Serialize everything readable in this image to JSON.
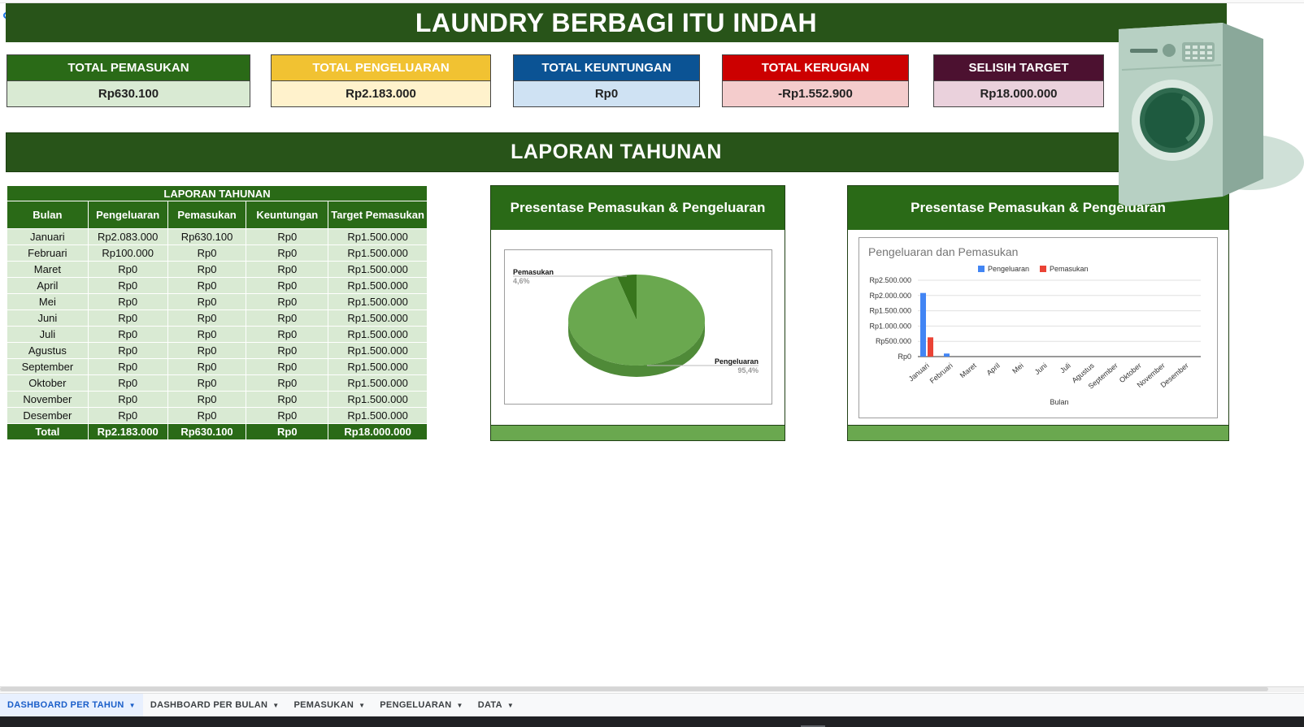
{
  "title": "LAUNDRY BERBAGI ITU INDAH",
  "kpis": [
    {
      "label": "TOTAL PEMASUKAN",
      "value": "Rp630.100"
    },
    {
      "label": "TOTAL PENGELUARAN",
      "value": "Rp2.183.000"
    },
    {
      "label": "TOTAL KEUNTUNGAN",
      "value": "Rp0"
    },
    {
      "label": "TOTAL KERUGIAN",
      "value": "-Rp1.552.900"
    },
    {
      "label": "SELISIH TARGET",
      "value": "Rp18.000.000"
    }
  ],
  "kpi_colors": {
    "pemasukan": {
      "head": "#2a6a17",
      "body": "#d9ead3"
    },
    "pengeluaran": {
      "head": "#f1c232",
      "body": "#fff2cc"
    },
    "keuntungan": {
      "head": "#0b5394",
      "body": "#cfe2f3"
    },
    "kerugian": {
      "head": "#cc0000",
      "body": "#f4cccc"
    },
    "selisih": {
      "head": "#4c1130",
      "body": "#ead1dc"
    }
  },
  "section_title": "LAPORAN TAHUNAN",
  "table": {
    "caption": "LAPORAN TAHUNAN",
    "headers": [
      "Bulan",
      "Pengeluaran",
      "Pemasukan",
      "Keuntungan",
      "Target Pemasukan"
    ],
    "rows": [
      [
        "Januari",
        "Rp2.083.000",
        "Rp630.100",
        "Rp0",
        "Rp1.500.000"
      ],
      [
        "Februari",
        "Rp100.000",
        "Rp0",
        "Rp0",
        "Rp1.500.000"
      ],
      [
        "Maret",
        "Rp0",
        "Rp0",
        "Rp0",
        "Rp1.500.000"
      ],
      [
        "April",
        "Rp0",
        "Rp0",
        "Rp0",
        "Rp1.500.000"
      ],
      [
        "Mei",
        "Rp0",
        "Rp0",
        "Rp0",
        "Rp1.500.000"
      ],
      [
        "Juni",
        "Rp0",
        "Rp0",
        "Rp0",
        "Rp1.500.000"
      ],
      [
        "Juli",
        "Rp0",
        "Rp0",
        "Rp0",
        "Rp1.500.000"
      ],
      [
        "Agustus",
        "Rp0",
        "Rp0",
        "Rp0",
        "Rp1.500.000"
      ],
      [
        "September",
        "Rp0",
        "Rp0",
        "Rp0",
        "Rp1.500.000"
      ],
      [
        "Oktober",
        "Rp0",
        "Rp0",
        "Rp0",
        "Rp1.500.000"
      ],
      [
        "November",
        "Rp0",
        "Rp0",
        "Rp0",
        "Rp1.500.000"
      ],
      [
        "Desember",
        "Rp0",
        "Rp0",
        "Rp0",
        "Rp1.500.000"
      ]
    ],
    "total": [
      "Total",
      "Rp2.183.000",
      "Rp630.100",
      "Rp0",
      "Rp18.000.000"
    ]
  },
  "pie_panel": {
    "title": "Presentase Pemasukan & Pengeluaran"
  },
  "bar_panel": {
    "title": "Presentase Pemasukan & Pengeluaran"
  },
  "chart_data": [
    {
      "type": "pie",
      "title": "",
      "slices": [
        {
          "label": "Pemasukan",
          "value": 4.6,
          "display": "4,6%",
          "color": "#38761d"
        },
        {
          "label": "Pengeluaran",
          "value": 95.4,
          "display": "95,4%",
          "color": "#6aa84f"
        }
      ]
    },
    {
      "type": "bar",
      "title": "Pengeluaran dan Pemasukan",
      "xlabel": "Bulan",
      "ylabel": "",
      "categories": [
        "Januari",
        "Februari",
        "Maret",
        "April",
        "Mei",
        "Juni",
        "Juli",
        "Agustus",
        "September",
        "Oktober",
        "November",
        "Desember"
      ],
      "series": [
        {
          "name": "Pengeluaran",
          "color": "#4285f4",
          "values": [
            2083000,
            100000,
            0,
            0,
            0,
            0,
            0,
            0,
            0,
            0,
            0,
            0
          ]
        },
        {
          "name": "Pemasukan",
          "color": "#ea4335",
          "values": [
            630100,
            0,
            0,
            0,
            0,
            0,
            0,
            0,
            0,
            0,
            0,
            0
          ]
        }
      ],
      "ylim": [
        0,
        2500000
      ],
      "yticks": [
        "Rp0",
        "Rp500.000",
        "Rp1.000.000",
        "Rp1.500.000",
        "Rp2.000.000",
        "Rp2.500.000"
      ],
      "legend": "top",
      "grid": true
    }
  ],
  "sheet_tabs": [
    {
      "label": "DASHBOARD PER TAHUN",
      "active": true
    },
    {
      "label": "DASHBOARD PER BULAN",
      "active": false
    },
    {
      "label": "PEMASUKAN",
      "active": false
    },
    {
      "label": "PENGELUARAN",
      "active": false
    },
    {
      "label": "DATA",
      "active": false
    }
  ],
  "icons": {
    "washer": "washing-machine-icon",
    "tab_caret": "caret-down-icon"
  }
}
